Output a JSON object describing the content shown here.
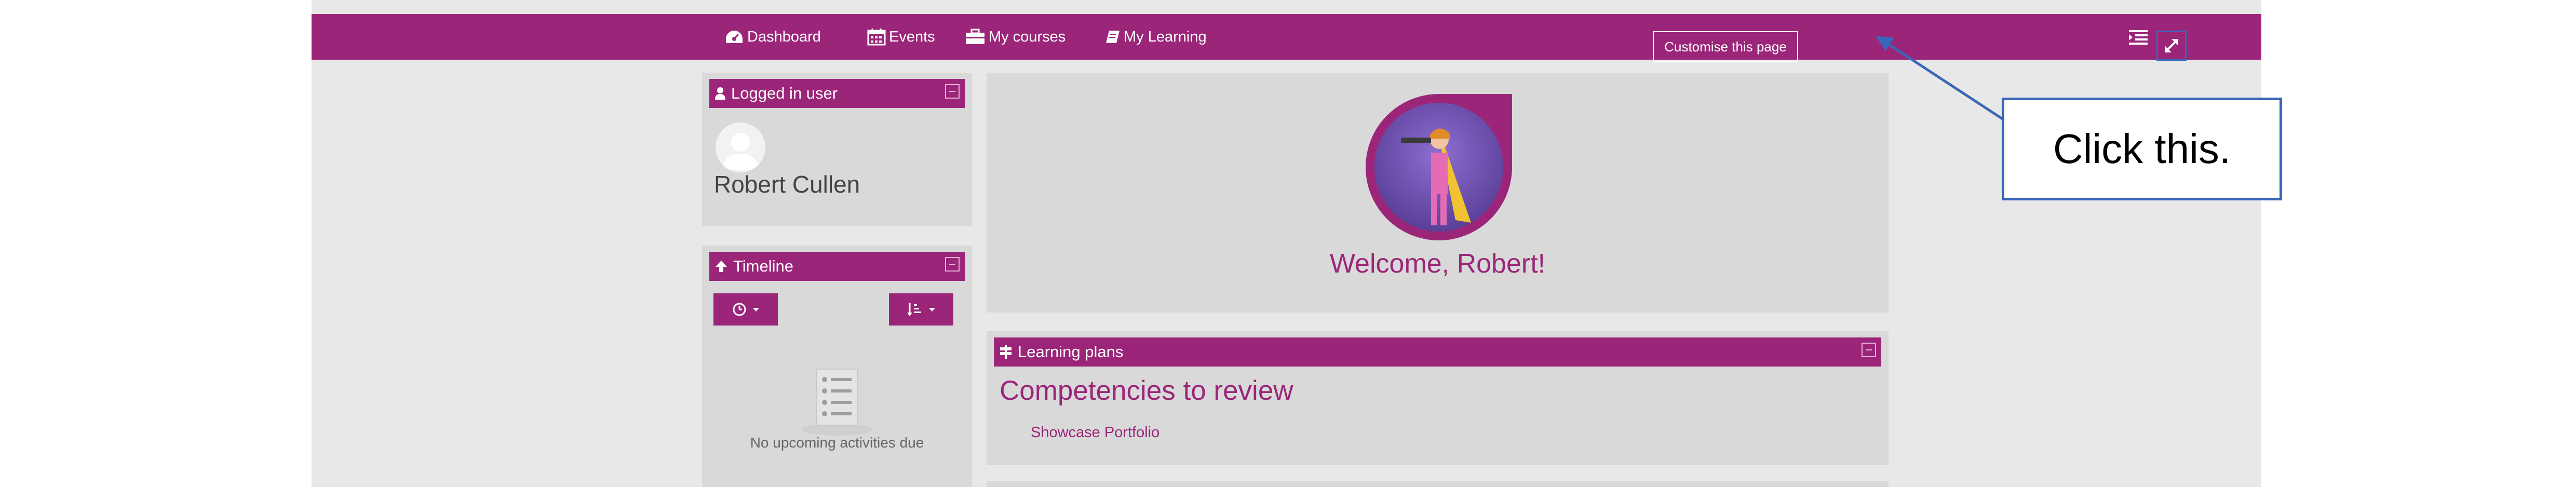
{
  "nav": {
    "dashboard": "Dashboard",
    "events": "Events",
    "my_courses": "My courses",
    "my_learning": "My Learning",
    "customise": "Customise this page"
  },
  "logged_in_block": {
    "title": "Logged in user",
    "user_name": "Robert Cullen"
  },
  "timeline_block": {
    "title": "Timeline",
    "empty_text": "No upcoming activities due"
  },
  "welcome_block": {
    "text": "Welcome, Robert!"
  },
  "learning_plans_block": {
    "title": "Learning plans",
    "heading": "Competencies to review",
    "link": "Showcase Portfolio"
  },
  "annotation": {
    "callout_text": "Click this."
  },
  "colors": {
    "brand": "#9b2679",
    "panel": "#d9d9d9",
    "page_bg": "#e8e8e8",
    "annotation": "#3a66b8"
  },
  "icons": [
    "dashboard-icon",
    "calendar-icon",
    "briefcase-icon",
    "book-icon",
    "list-indent-icon",
    "expand-icon",
    "user-icon",
    "upload-icon",
    "clock-icon",
    "sort-icon",
    "minus-icon"
  ]
}
